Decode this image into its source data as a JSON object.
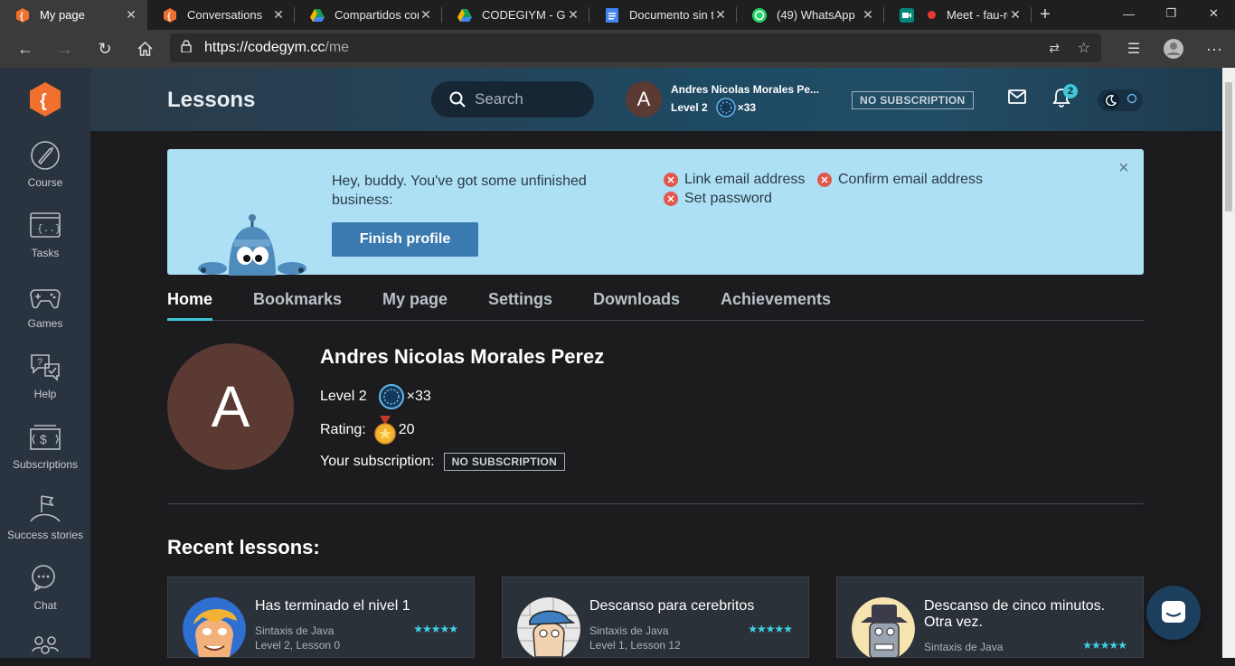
{
  "browser": {
    "tabs": [
      {
        "label": "My page",
        "icon": "codegym-icon",
        "active": true
      },
      {
        "label": "Conversations",
        "icon": "codegym-icon"
      },
      {
        "label": "Compartidos conm",
        "icon": "drive-icon"
      },
      {
        "label": "CODEGIYM - Goo",
        "icon": "drive-icon"
      },
      {
        "label": "Documento sin tít",
        "icon": "docs-icon"
      },
      {
        "label": "(49) WhatsApp",
        "icon": "whatsapp-icon"
      },
      {
        "label": "Meet - fau-ro",
        "icon": "meet-icon",
        "recording": true
      }
    ],
    "url_host": "https://codegym.cc",
    "url_path": "/me"
  },
  "sidebar": {
    "items": [
      {
        "label": "Course"
      },
      {
        "label": "Tasks"
      },
      {
        "label": "Games"
      },
      {
        "label": "Help"
      },
      {
        "label": "Subscriptions"
      },
      {
        "label": "Success stories"
      },
      {
        "label": "Chat"
      }
    ]
  },
  "header": {
    "title": "Lessons",
    "search_placeholder": "Search",
    "avatar_letter": "A",
    "user_name": "Andres Nicolas Morales Pe...",
    "level": "Level 2",
    "gems": "×33",
    "subscription_badge": "NO SUBSCRIPTION",
    "notification_count": "2"
  },
  "banner": {
    "message": "Hey, buddy. You've got some unfinished business:",
    "button": "Finish profile",
    "tasks": [
      "Link email address",
      "Confirm email address",
      "Set password"
    ],
    "close": "×"
  },
  "profile_tabs": [
    "Home",
    "Bookmarks",
    "My page",
    "Settings",
    "Downloads",
    "Achievements"
  ],
  "profile": {
    "avatar_letter": "A",
    "name": "Andres Nicolas Morales Perez",
    "level": "Level 2",
    "gems": "×33",
    "rating_label": "Rating:",
    "rating_value": "20",
    "subscription_label": "Your subscription:",
    "subscription_badge": "NO SUBSCRIPTION"
  },
  "recent": {
    "title": "Recent lessons:",
    "cards": [
      {
        "title": "Has terminado el nivel 1",
        "course": "Sintaxis de Java",
        "lesson": "Level 2, Lesson 0",
        "stars": "★★★★★"
      },
      {
        "title": "Descanso para cerebritos",
        "course": "Sintaxis de Java",
        "lesson": "Level 1, Lesson 12",
        "stars": "★★★★★"
      },
      {
        "title": "Descanso de cinco minutos. Otra vez.",
        "course": "Sintaxis de Java",
        "lesson": "",
        "stars": "★★★★★"
      }
    ]
  },
  "colors": {
    "accent": "#3fc7d8",
    "banner": "#aee0f5",
    "button": "#3b7ab0",
    "brand": "#f0702d"
  }
}
